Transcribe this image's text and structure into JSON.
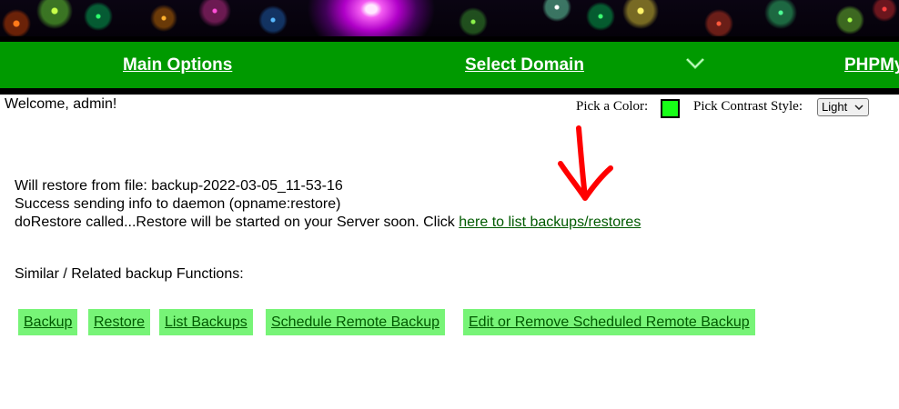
{
  "nav": {
    "items": [
      {
        "label": "Main Options"
      },
      {
        "label": "Select Domain"
      },
      {
        "label": "PHPMy"
      }
    ]
  },
  "header": {
    "welcome": "Welcome, admin!",
    "pick_color_label": "Pick a Color:",
    "picked_color": "#17ff17",
    "contrast_label": "Pick Contrast Style:",
    "contrast_value": "Light"
  },
  "messages": {
    "line1": "Will restore from file: backup-2022-03-05_11-53-16",
    "line2": "Success sending info to daemon (opname:restore)",
    "line3_prefix": "doRestore called...Restore will be started on your Server soon. Click ",
    "line3_link": "here to list backups/restores"
  },
  "related": {
    "heading": "Similar / Related backup Functions:",
    "buttons": [
      {
        "label": "Backup"
      },
      {
        "label": "Restore"
      },
      {
        "label": "List Backups"
      },
      {
        "label": "Schedule Remote Backup"
      },
      {
        "label": "Edit or Remove Scheduled Remote Backup"
      }
    ]
  },
  "colors": {
    "nav_bg": "#009a00",
    "button_bg": "#77f477",
    "link": "#005a00",
    "annotation_arrow": "#ff0000"
  }
}
